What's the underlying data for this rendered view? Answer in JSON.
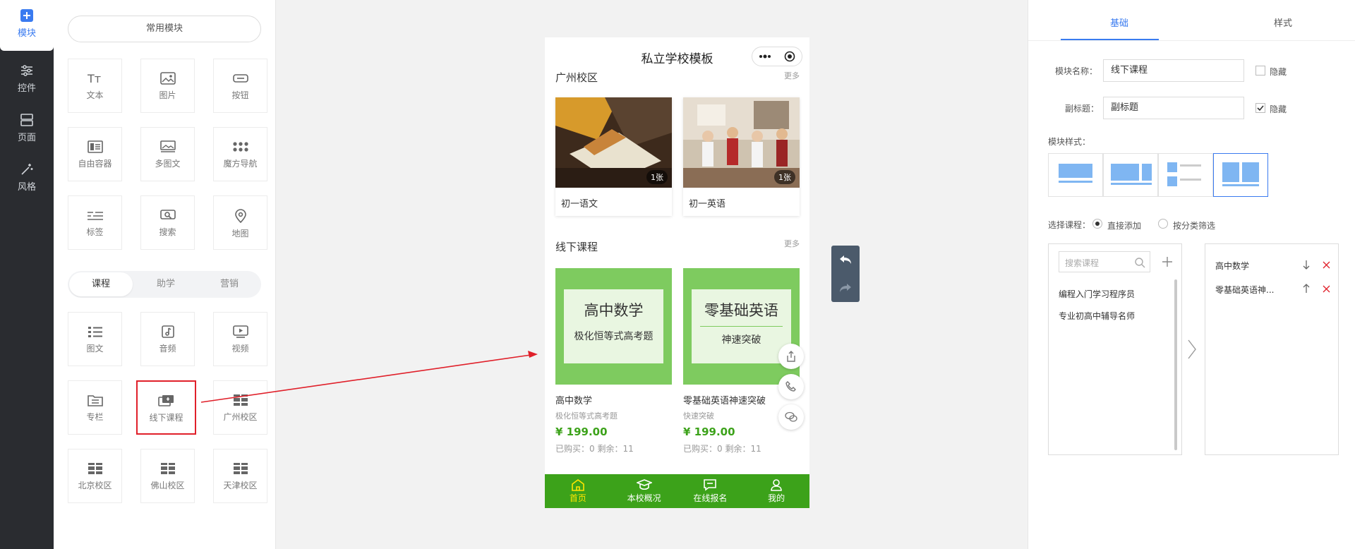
{
  "rail": {
    "items": [
      {
        "label": "模块",
        "icon": "plus-square-icon"
      },
      {
        "label": "控件",
        "icon": "sliders-icon"
      },
      {
        "label": "页面",
        "icon": "pages-icon"
      },
      {
        "label": "风格",
        "icon": "magic-wand-icon"
      }
    ]
  },
  "palette": {
    "common_label": "常用模块",
    "basic_tiles": [
      {
        "label": "文本",
        "icon": "text-icon"
      },
      {
        "label": "图片",
        "icon": "image-icon"
      },
      {
        "label": "按钮",
        "icon": "button-icon"
      },
      {
        "label": "自由容器",
        "icon": "container-icon"
      },
      {
        "label": "多图文",
        "icon": "multi-image-icon"
      },
      {
        "label": "魔方导航",
        "icon": "grid-dots-icon"
      },
      {
        "label": "标签",
        "icon": "tag-icon"
      },
      {
        "label": "搜索",
        "icon": "search-icon"
      },
      {
        "label": "地图",
        "icon": "map-pin-icon"
      }
    ],
    "tabs": [
      "课程",
      "助学",
      "营销"
    ],
    "course_tiles": [
      {
        "label": "图文",
        "icon": "list-icon"
      },
      {
        "label": "音频",
        "icon": "music-icon"
      },
      {
        "label": "视频",
        "icon": "video-icon"
      },
      {
        "label": "专栏",
        "icon": "folder-icon"
      },
      {
        "label": "线下课程",
        "icon": "offline-course-icon"
      },
      {
        "label": "广州校区",
        "icon": "campus-icon"
      },
      {
        "label": "北京校区",
        "icon": "campus-icon"
      },
      {
        "label": "佛山校区",
        "icon": "campus-icon"
      },
      {
        "label": "天津校区",
        "icon": "campus-icon"
      }
    ]
  },
  "phone": {
    "title": "私立学校模板",
    "section1": {
      "title": "广州校区",
      "more": "更多",
      "cards": [
        {
          "caption": "初一语文",
          "badge": "1张"
        },
        {
          "caption": "初一英语",
          "badge": "1张"
        }
      ]
    },
    "section2": {
      "title": "线下课程",
      "more": "更多",
      "courses": [
        {
          "cover_big": "高中数学",
          "cover_small": "极化恒等式高考题",
          "name": "高中数学",
          "desc": "极化恒等式高考题",
          "price": "¥ 199.00",
          "stats": "已购买：0  剩余：11"
        },
        {
          "cover_big": "零基础英语",
          "cover_small": "神速突破",
          "name": "零基础英语神速突破",
          "desc": "快速突破",
          "price": "¥ 199.00",
          "stats": "已购买：0  剩余：11"
        }
      ]
    },
    "tabbar": [
      {
        "label": "首页",
        "icon": "home-icon"
      },
      {
        "label": "本校概况",
        "icon": "graduation-cap-icon"
      },
      {
        "label": "在线报名",
        "icon": "chat-icon"
      },
      {
        "label": "我的",
        "icon": "user-icon"
      }
    ],
    "fabs": [
      "share-icon",
      "phone-icon",
      "wechat-icon"
    ]
  },
  "props": {
    "tabs": [
      "基础",
      "样式"
    ],
    "module_name_label": "模块名称：",
    "module_name_value": "线下课程",
    "hide_label": "隐藏",
    "subtitle_label": "副标题：",
    "subtitle_value": "副标题",
    "style_label": "模块样式：",
    "select_label": "选择课程：",
    "radio_direct": "直接添加",
    "radio_category": "按分类筛选",
    "search_placeholder": "搜索课程",
    "available": [
      "编程入门学习程序员",
      "专业初高中辅导名师"
    ],
    "selected": [
      "高中数学",
      "零基础英语神..."
    ]
  },
  "colors": {
    "accent": "#3a7bf0",
    "green": "#3ca21a",
    "highlight": "#e0202a"
  }
}
